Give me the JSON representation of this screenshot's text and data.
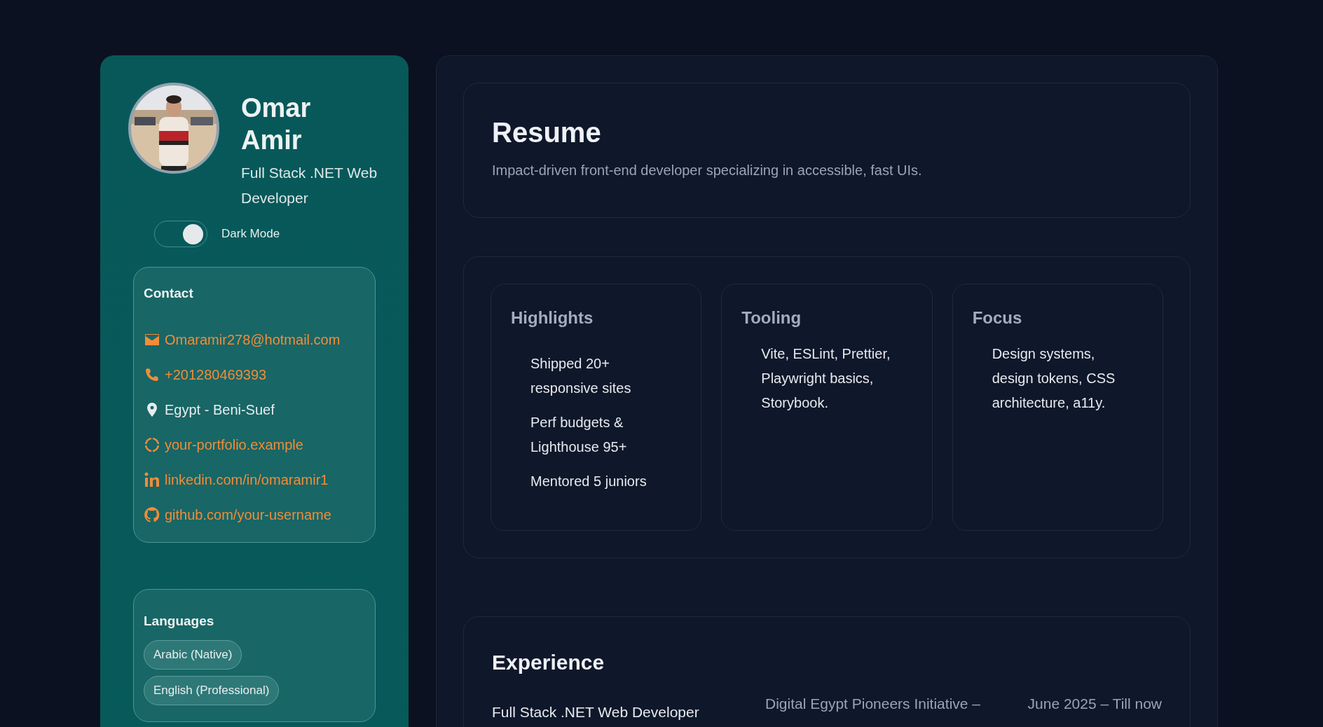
{
  "profile": {
    "name": "Omar Amir",
    "title": "Full Stack .NET Web Developer"
  },
  "theme_toggle": {
    "label": "Dark Mode",
    "on": true
  },
  "contact": {
    "title": "Contact",
    "items": [
      {
        "kind": "email",
        "text": "Omaramir278@hotmail.com",
        "link": true
      },
      {
        "kind": "phone",
        "text": "+201280469393",
        "link": true
      },
      {
        "kind": "location",
        "text": "Egypt - Beni-Suef",
        "link": false
      },
      {
        "kind": "website",
        "text": "your-portfolio.example",
        "link": true
      },
      {
        "kind": "linkedin",
        "text": "linkedin.com/in/omaramir1",
        "link": true
      },
      {
        "kind": "github",
        "text": "github.com/your-username",
        "link": true
      }
    ]
  },
  "languages": {
    "title": "Languages",
    "items": [
      "Arabic (Native)",
      "English (Professional)"
    ]
  },
  "header": {
    "title": "Resume",
    "summary": "Impact-driven front-end developer specializing in accessible, fast UIs."
  },
  "cards": [
    {
      "title": "Highlights",
      "kind": "list",
      "items": [
        "Shipped 20+ responsive sites",
        "Perf budgets & Lighthouse 95+",
        "Mentored 5 juniors"
      ]
    },
    {
      "title": "Tooling",
      "kind": "text",
      "text": "Vite, ESLint, Prettier, Playwright basics, Storybook."
    },
    {
      "title": "Focus",
      "kind": "text",
      "text": "Design systems, design tokens, CSS architecture, a11y."
    }
  ],
  "experience": {
    "title": "Experience",
    "entries": [
      {
        "role": "Full Stack .NET Web Developer",
        "organization": "Digital Egypt Pioneers Initiative –",
        "period": "June 2025 – Till now"
      }
    ]
  }
}
